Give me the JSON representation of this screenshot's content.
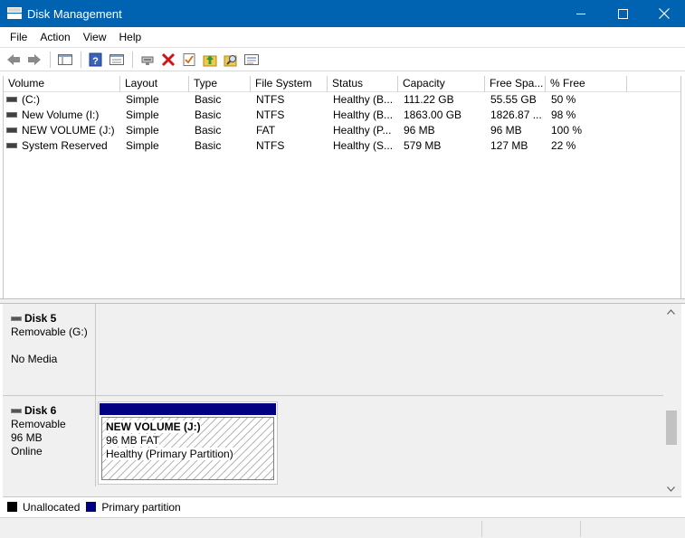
{
  "window": {
    "title": "Disk Management"
  },
  "menu": {
    "items": [
      "File",
      "Action",
      "View",
      "Help"
    ]
  },
  "toolbar": {
    "buttons": [
      "back-icon",
      "forward-icon",
      "show-hide-tree-icon",
      "help-icon",
      "properties-icon",
      "connect-icon",
      "delete-icon",
      "checkmark-icon",
      "folder-up-icon",
      "folder-search-icon",
      "list-icon"
    ]
  },
  "volume_list": {
    "columns": [
      "Volume",
      "Layout",
      "Type",
      "File System",
      "Status",
      "Capacity",
      "Free Spa...",
      "% Free"
    ],
    "rows": [
      [
        "(C:)",
        "Simple",
        "Basic",
        "NTFS",
        "Healthy (B...",
        "111.22 GB",
        "55.55 GB",
        "50 %"
      ],
      [
        "New Volume (I:)",
        "Simple",
        "Basic",
        "NTFS",
        "Healthy (B...",
        "1863.00 GB",
        "1826.87 ...",
        "98 %"
      ],
      [
        "NEW VOLUME (J:)",
        "Simple",
        "Basic",
        "FAT",
        "Healthy (P...",
        "96 MB",
        "96 MB",
        "100 %"
      ],
      [
        "System Reserved",
        "Simple",
        "Basic",
        "NTFS",
        "Healthy (S...",
        "579 MB",
        "127 MB",
        "22 %"
      ]
    ]
  },
  "disks": [
    {
      "name": "Disk 5",
      "line1": "Removable (G:)",
      "line2": "",
      "line3": "No Media"
    },
    {
      "name": "Disk 6",
      "line1": "Removable",
      "line2": "96 MB",
      "line3": "Online",
      "partition": {
        "title": "NEW VOLUME  (J:)",
        "fs": "96 MB FAT",
        "status": "Healthy (Primary Partition)"
      }
    }
  ],
  "legend": {
    "items": [
      {
        "label": "Unallocated",
        "color": "#000000"
      },
      {
        "label": "Primary partition",
        "color": "#000080"
      }
    ]
  },
  "colors": {
    "titlebar": "#0063b1",
    "primary_partition": "#000080"
  }
}
